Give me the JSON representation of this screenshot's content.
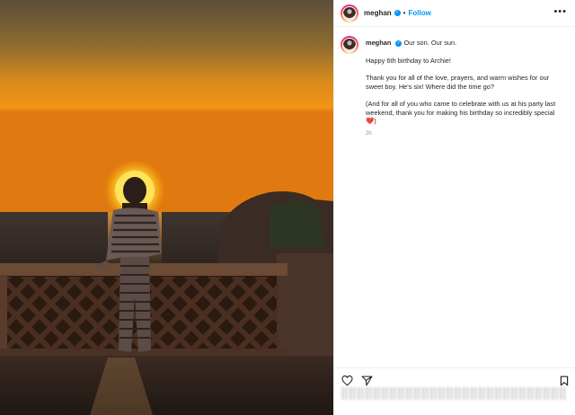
{
  "header": {
    "username": "meghan",
    "separator": "•",
    "follow_label": "Follow",
    "more_label": "•••"
  },
  "caption": {
    "username": "meghan",
    "first_line": "Our son. Our sun.",
    "paragraphs": [
      "Happy 6th birthday to Archie!",
      "Thank you for all of the love, prayers, and warm wishes for our sweet boy. He's six! Where did the time go?",
      "(And for all of you who came to celebrate with us at his party last weekend, thank you for making his birthday so incredibly special"
    ],
    "closing": ")",
    "heart": "❤️",
    "timestamp": "2h"
  },
  "icons": {
    "verified": "verified-badge-icon",
    "like": "heart-icon",
    "share": "paper-plane-icon",
    "save": "bookmark-icon"
  },
  "colors": {
    "link_blue": "#0095f6",
    "text": "#262626",
    "muted": "#8e8e8e",
    "sunset_orange": "#f08a12"
  }
}
